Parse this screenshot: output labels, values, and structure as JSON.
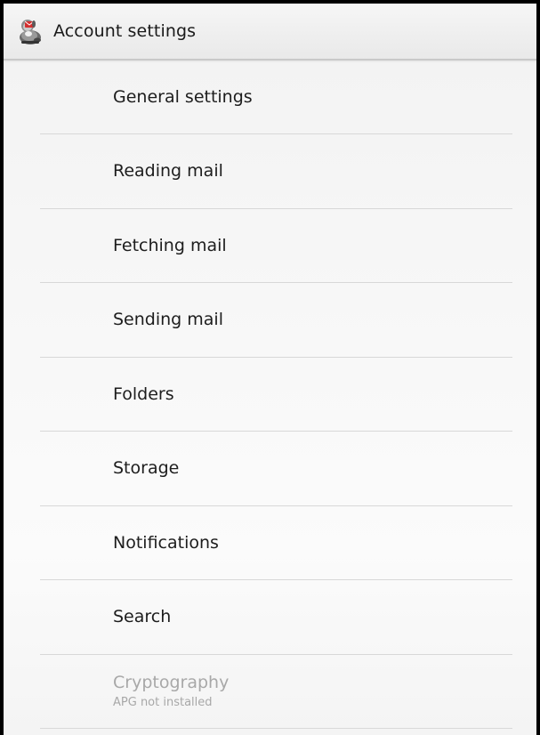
{
  "header": {
    "title": "Account settings",
    "icon": "k9-mail-app-icon"
  },
  "settings": {
    "items": [
      {
        "label": "General settings",
        "enabled": true
      },
      {
        "label": "Reading mail",
        "enabled": true
      },
      {
        "label": "Fetching mail",
        "enabled": true
      },
      {
        "label": "Sending mail",
        "enabled": true
      },
      {
        "label": "Folders",
        "enabled": true
      },
      {
        "label": "Storage",
        "enabled": true
      },
      {
        "label": "Notifications",
        "enabled": true
      },
      {
        "label": "Search",
        "enabled": true
      },
      {
        "label": "Cryptography",
        "summary": "APG not installed",
        "enabled": false
      }
    ]
  },
  "colors": {
    "text": "#1d1d1d",
    "disabled_text": "#a8a8a8",
    "divider": "#d8d8d8",
    "action_bar": "#eeeeee",
    "border": "#000000"
  }
}
